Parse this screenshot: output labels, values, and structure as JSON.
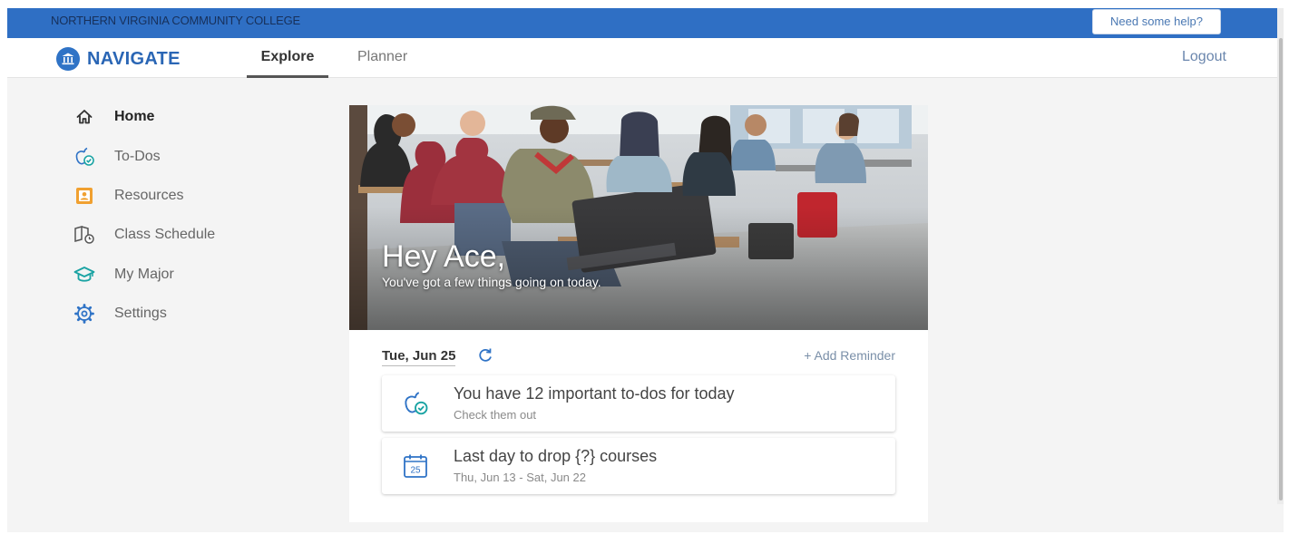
{
  "header": {
    "college_name": "NORTHERN VIRGINIA COMMUNITY COLLEGE",
    "help_label": "Need some help?"
  },
  "nav": {
    "brand": "NAVIGATE",
    "tabs": [
      {
        "label": "Explore",
        "active": true
      },
      {
        "label": "Planner",
        "active": false
      }
    ],
    "logout_label": "Logout"
  },
  "sidebar": {
    "items": [
      {
        "label": "Home",
        "icon": "home-icon",
        "active": true
      },
      {
        "label": "To-Dos",
        "icon": "apple-check-icon"
      },
      {
        "label": "Resources",
        "icon": "resources-icon"
      },
      {
        "label": "Class Schedule",
        "icon": "class-schedule-icon"
      },
      {
        "label": "My Major",
        "icon": "graduation-cap-icon"
      },
      {
        "label": "Settings",
        "icon": "gear-icon"
      }
    ]
  },
  "hero": {
    "greeting": "Hey Ace,",
    "subtitle": "You've got a few things going on today."
  },
  "agenda": {
    "date": "Tue, Jun 25",
    "add_reminder": "+ Add Reminder",
    "items": [
      {
        "icon": "apple-check-icon",
        "title": "You have 12 important to-dos for today",
        "subtitle": "Check them out"
      },
      {
        "icon": "calendar-icon",
        "calendar_day": "25",
        "title": "Last day to drop {?} courses",
        "subtitle": "Thu, Jun 13 - Sat, Jun 22"
      }
    ]
  },
  "colors": {
    "topbar": "#2f6fc4",
    "brand": "#2a66b5",
    "icon_teal": "#1aa3a3",
    "icon_blue": "#2f73c6",
    "icon_orange": "#f0a030"
  }
}
